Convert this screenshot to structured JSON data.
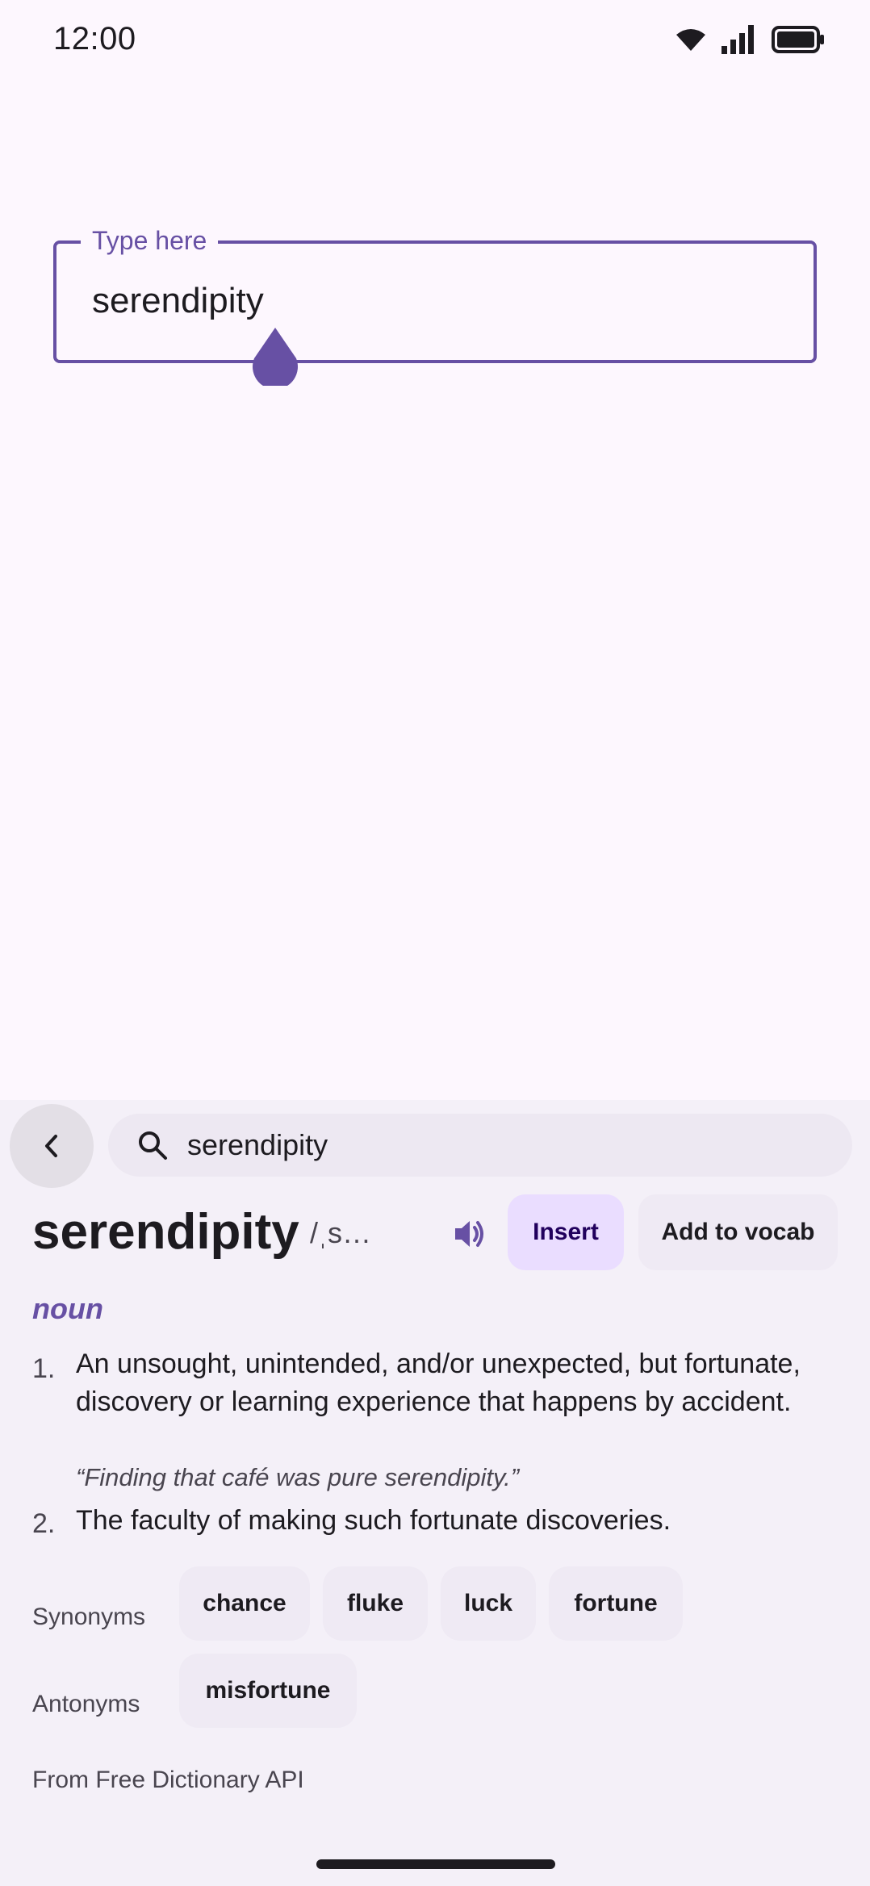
{
  "status_bar": {
    "time": "12:00"
  },
  "text_field": {
    "label": "Type here",
    "value": "serendipity"
  },
  "sheet": {
    "search_query": "serendipity",
    "word": "serendipity",
    "phonetic": "/ˌs…",
    "insert_label": "Insert",
    "add_vocab_label": "Add to vocab",
    "part_of_speech": "noun",
    "definitions": [
      {
        "number": "1.",
        "text": "An unsought, unintended, and/or unexpected, but fortunate, discovery or learning experience that happens by accident.",
        "example": "“Finding that café was pure serendipity.”"
      },
      {
        "number": "2.",
        "text": "The faculty of making such fortunate discoveries."
      }
    ],
    "synonyms_label": "Synonyms",
    "synonyms": [
      "chance",
      "fluke",
      "luck",
      "fortune"
    ],
    "antonyms_label": "Antonyms",
    "antonyms": [
      "misfortune"
    ],
    "source": "From Free Dictionary API"
  },
  "colors": {
    "primary": "#6750a4",
    "background": "#fdf7fe",
    "sheet": "#f4f0f8",
    "insert_container": "#eaddff"
  },
  "icons": [
    "wifi-icon",
    "signal-icon",
    "battery-icon",
    "back-arrow-icon",
    "search-icon",
    "speaker-icon",
    "caret-handle-icon"
  ]
}
